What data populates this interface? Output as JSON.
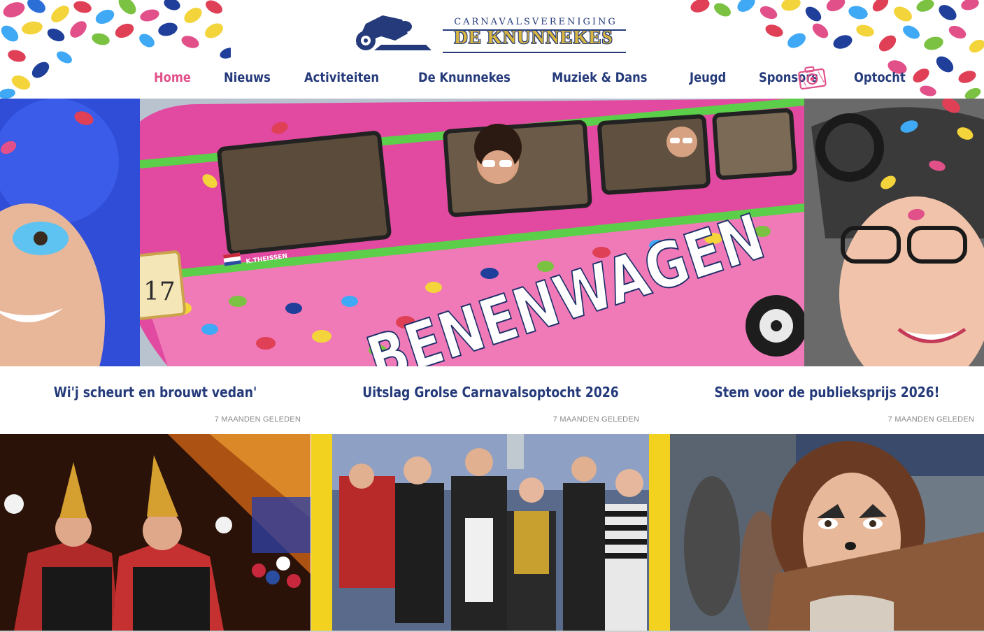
{
  "brand": {
    "subtitle": "CARNAVALSVERENIGING",
    "name": "DE KNUNNEKES",
    "colors": {
      "navy": "#243a7a",
      "pink": "#e2508a",
      "gold": "#d8b640"
    }
  },
  "nav": {
    "items": [
      {
        "label": "Home",
        "active": true
      },
      {
        "label": "Nieuws"
      },
      {
        "label": "Activiteiten"
      },
      {
        "label": "De Knunnekes"
      },
      {
        "label": "Muziek & Dans"
      },
      {
        "label": "Jeugd"
      },
      {
        "label": "Sponsors"
      },
      {
        "label": "Optocht"
      }
    ],
    "camera_icon": "camera-icon"
  },
  "hero": {
    "vehicle_text": "BENENWAGEN",
    "plate_text": "K.THEISSEN",
    "number_sign": "17"
  },
  "news": [
    {
      "title": "Wi'j scheurt en brouwt vedan'",
      "date": "7 MAANDEN GELEDEN"
    },
    {
      "title": "Uitslag Grolse Carnavalsoptocht 2026",
      "date": "7 MAANDEN GELEDEN"
    },
    {
      "title": "Stem voor de publieksprijs 2026!",
      "date": "7 MAANDEN GELEDEN"
    }
  ]
}
